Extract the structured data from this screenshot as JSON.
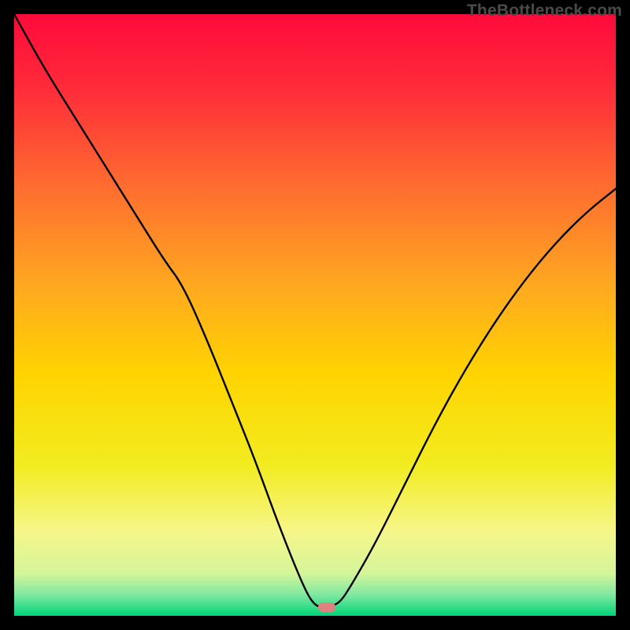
{
  "watermark": "TheBottleneck.com",
  "chart_data": {
    "type": "line",
    "title": "",
    "xlabel": "",
    "ylabel": "",
    "xlim": [
      0,
      100
    ],
    "ylim": [
      0,
      100
    ],
    "grid": false,
    "legend": false,
    "background_gradient": {
      "stops": [
        {
          "pos": 0.0,
          "color": "#ff0a3b"
        },
        {
          "pos": 0.12,
          "color": "#ff2a3a"
        },
        {
          "pos": 0.28,
          "color": "#ff6a30"
        },
        {
          "pos": 0.45,
          "color": "#ffa820"
        },
        {
          "pos": 0.6,
          "color": "#ffd400"
        },
        {
          "pos": 0.75,
          "color": "#f2ec20"
        },
        {
          "pos": 0.86,
          "color": "#f6f68a"
        },
        {
          "pos": 0.93,
          "color": "#d4f59a"
        },
        {
          "pos": 0.965,
          "color": "#7fe8a0"
        },
        {
          "pos": 1.0,
          "color": "#00d47a"
        }
      ]
    },
    "series": [
      {
        "name": "bottleneck-curve",
        "color": "#000000",
        "x": [
          0,
          5,
          10,
          15,
          20,
          25,
          28,
          32,
          36,
          40,
          44,
          48,
          50,
          52,
          54,
          56,
          60,
          65,
          70,
          75,
          80,
          85,
          90,
          95,
          100
        ],
        "y": [
          100,
          91,
          83,
          75,
          67,
          59,
          55,
          46,
          36,
          26,
          15,
          5,
          1.5,
          1.5,
          2,
          5,
          12,
          22,
          32,
          41,
          49,
          56,
          62,
          67,
          71
        ]
      }
    ],
    "marker": {
      "x": 52,
      "y": 1.5,
      "color": "#e08080"
    }
  }
}
